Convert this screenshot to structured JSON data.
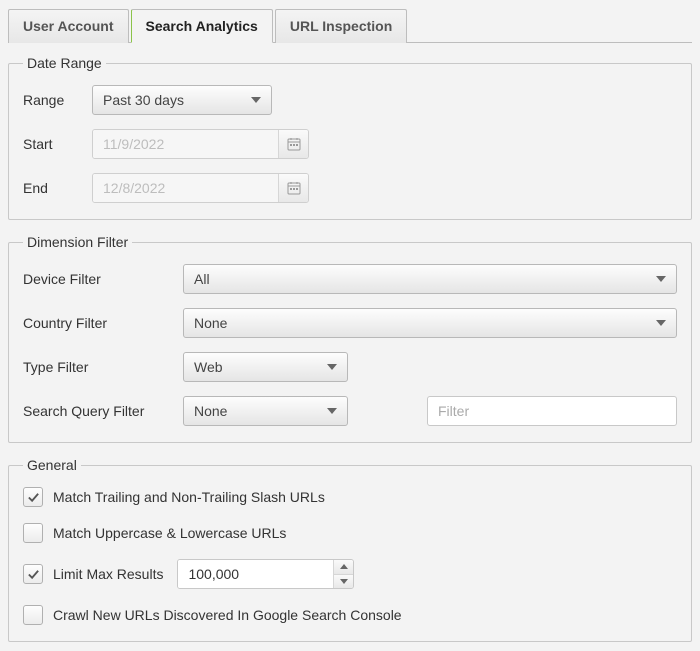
{
  "tabs": {
    "user_account": "User Account",
    "search_analytics": "Search Analytics",
    "url_inspection": "URL Inspection"
  },
  "date_range": {
    "legend": "Date Range",
    "range_label": "Range",
    "range_value": "Past 30 days",
    "start_label": "Start",
    "start_value": "11/9/2022",
    "end_label": "End",
    "end_value": "12/8/2022"
  },
  "dimension_filter": {
    "legend": "Dimension Filter",
    "device_label": "Device Filter",
    "device_value": "All",
    "country_label": "Country Filter",
    "country_value": "None",
    "type_label": "Type Filter",
    "type_value": "Web",
    "query_label": "Search Query Filter",
    "query_value": "None",
    "query_text_placeholder": "Filter"
  },
  "general": {
    "legend": "General",
    "match_slash_label": "Match Trailing and Non-Trailing Slash URLs",
    "match_case_label": "Match Uppercase & Lowercase URLs",
    "limit_max_label": "Limit Max Results",
    "limit_max_value": "100,000",
    "crawl_new_label": "Crawl New URLs Discovered In Google Search Console"
  }
}
